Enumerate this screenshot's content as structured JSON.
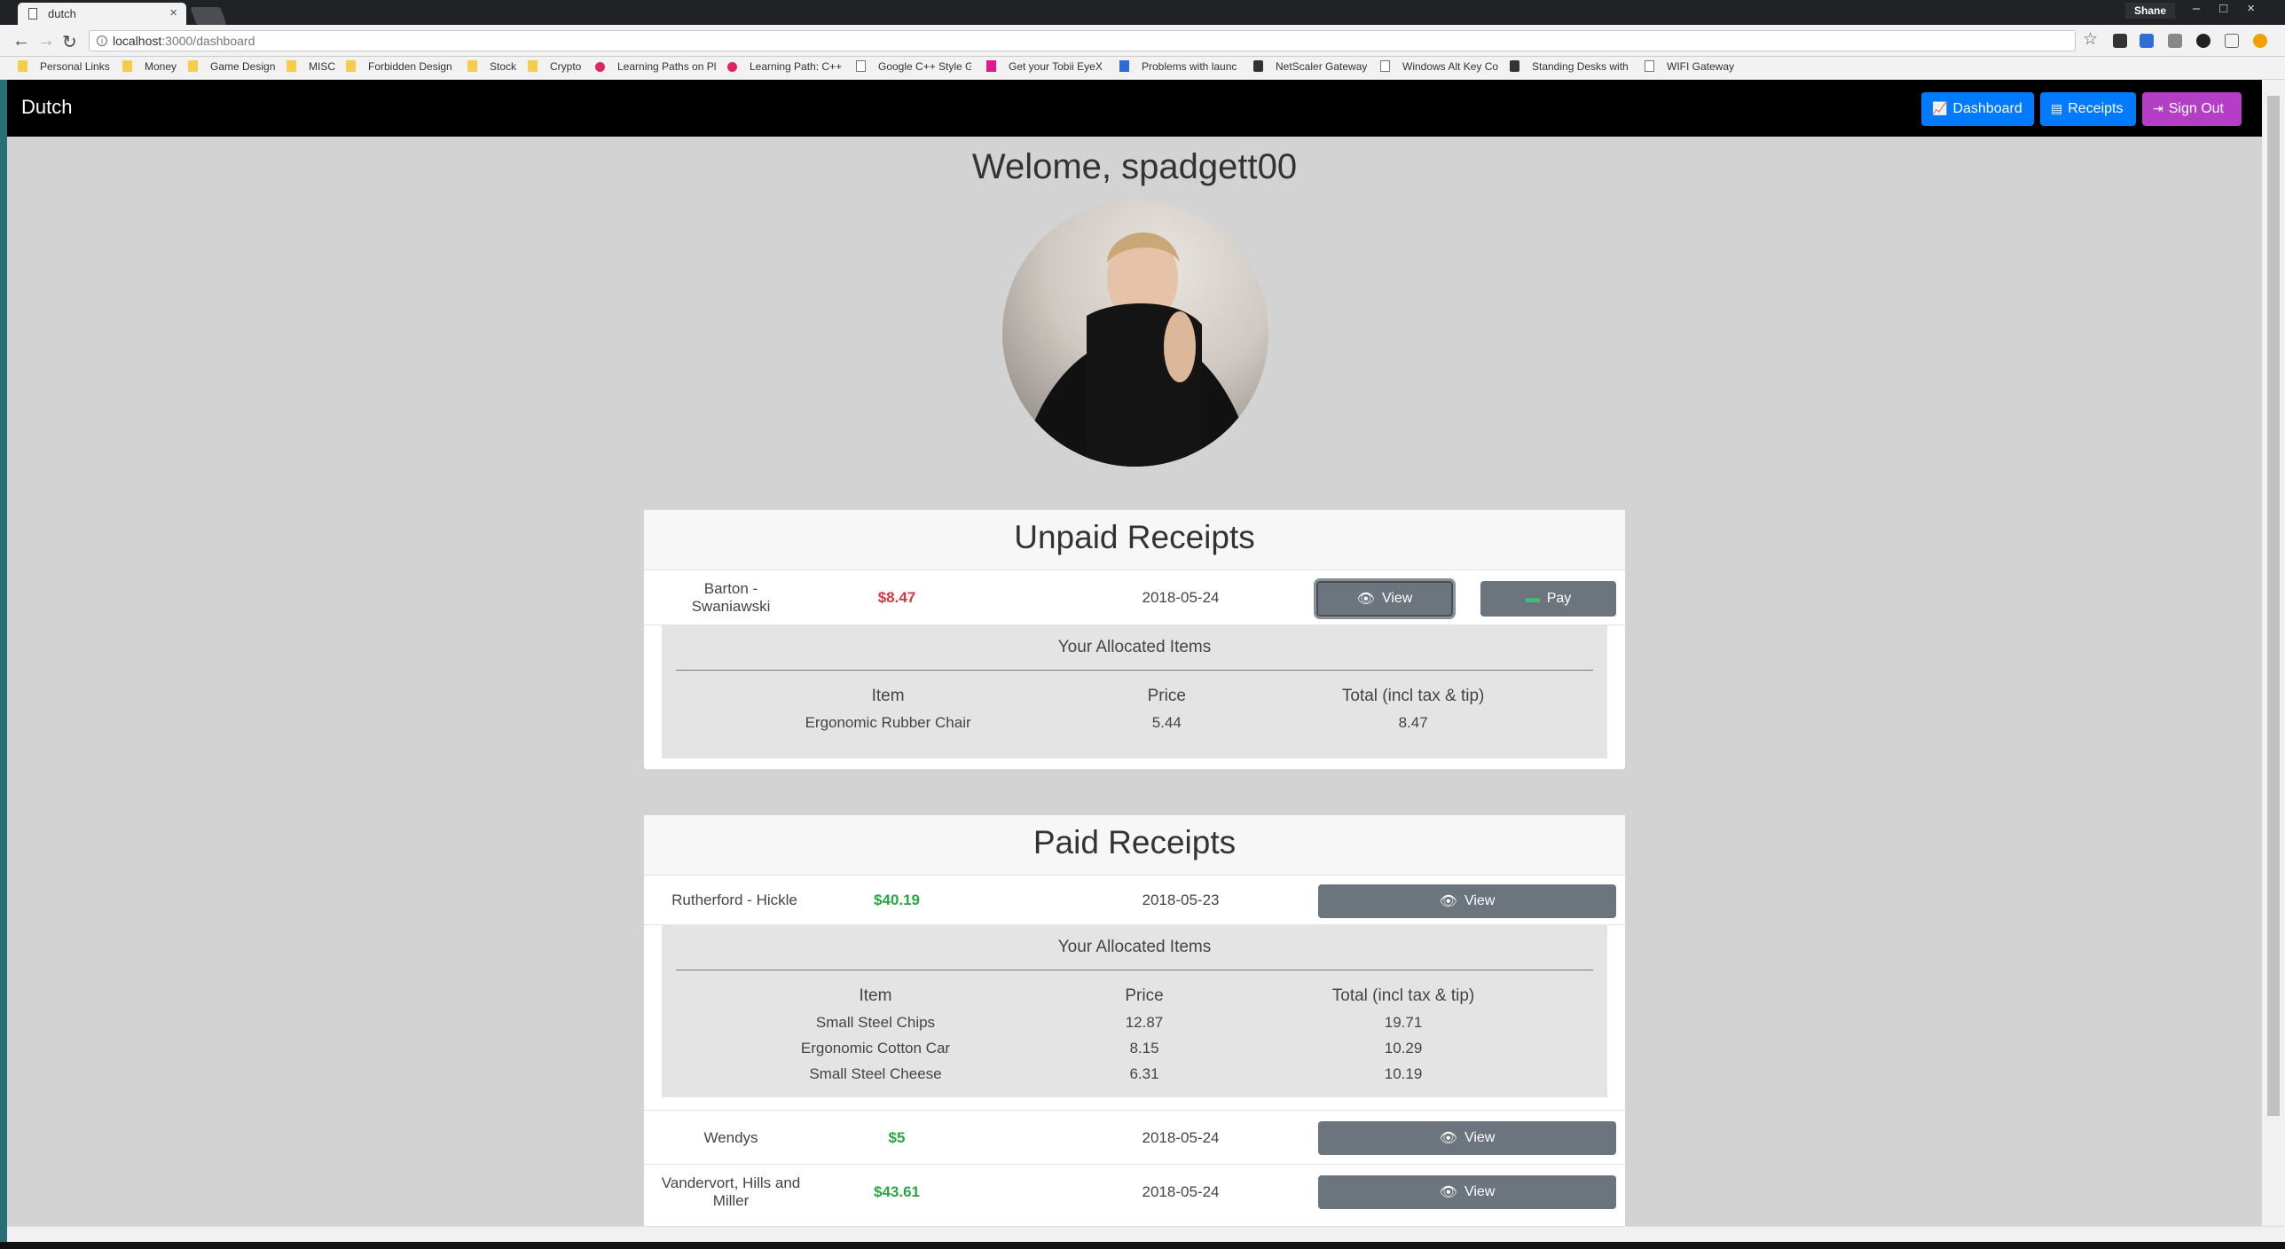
{
  "browser": {
    "tab_title": "dutch",
    "user_name": "Shane",
    "url_host": "localhost",
    "url_path": ":3000/dashboard",
    "bookmarks": [
      {
        "label": "Personal Links",
        "icon": "folder-icon"
      },
      {
        "label": "Money",
        "icon": "folder-icon"
      },
      {
        "label": "Game Design",
        "icon": "folder-icon"
      },
      {
        "label": "MISC",
        "icon": "folder-icon"
      },
      {
        "label": "Forbidden Design",
        "icon": "folder-icon"
      },
      {
        "label": "Stock",
        "icon": "folder-icon"
      },
      {
        "label": "Crypto",
        "icon": "folder-icon"
      },
      {
        "label": "Learning Paths on Pl",
        "icon": "red-circle-icon"
      },
      {
        "label": "Learning Path: C++",
        "icon": "red-circle-icon"
      },
      {
        "label": "Google C++ Style G",
        "icon": "page-icon"
      },
      {
        "label": "Get your Tobii EyeX",
        "icon": "pink-square-icon"
      },
      {
        "label": "Problems with launc",
        "icon": "blue-icon"
      },
      {
        "label": "NetScaler Gateway",
        "icon": "dark-icon"
      },
      {
        "label": "Windows Alt Key Co",
        "icon": "page-icon"
      },
      {
        "label": "Standing Desks with",
        "icon": "dark-icon"
      },
      {
        "label": "WIFI Gateway",
        "icon": "page-icon"
      }
    ]
  },
  "app": {
    "brand": "Dutch",
    "nav": {
      "dashboard": "Dashboard",
      "receipts": "Receipts",
      "sign_out": "Sign Out"
    },
    "welcome": "Welome, spadgett00",
    "colors": {
      "primary": "#007bff",
      "signout": "#b53ec7",
      "unpaid": "#dc3545",
      "paid": "#28a745",
      "secondary": "#6c757d"
    }
  },
  "unpaid": {
    "title": "Unpaid Receipts",
    "receipts": [
      {
        "name": "Barton - Swaniawski",
        "amount": "$8.47",
        "date": "2018-05-24",
        "view_label": "View",
        "pay_label": "Pay",
        "details": {
          "title": "Your Allocated Items",
          "headers": [
            "Item",
            "Price",
            "Total (incl tax & tip)"
          ],
          "rows": [
            [
              "Ergonomic Rubber Chair",
              "5.44",
              "8.47"
            ]
          ]
        }
      }
    ]
  },
  "paid": {
    "title": "Paid Receipts",
    "receipts": [
      {
        "name": "Rutherford - Hickle",
        "amount": "$40.19",
        "date": "2018-05-23",
        "view_label": "View",
        "details": {
          "title": "Your Allocated Items",
          "headers": [
            "Item",
            "Price",
            "Total (incl tax & tip)"
          ],
          "rows": [
            [
              "Small Steel Chips",
              "12.87",
              "19.71"
            ],
            [
              "Ergonomic Cotton Car",
              "8.15",
              "10.29"
            ],
            [
              "Small Steel Cheese",
              "6.31",
              "10.19"
            ]
          ]
        }
      },
      {
        "name": "Wendys",
        "amount": "$5",
        "date": "2018-05-24",
        "view_label": "View"
      },
      {
        "name": "Vandervort, Hills and Miller",
        "amount": "$43.61",
        "date": "2018-05-24",
        "view_label": "View"
      }
    ]
  }
}
